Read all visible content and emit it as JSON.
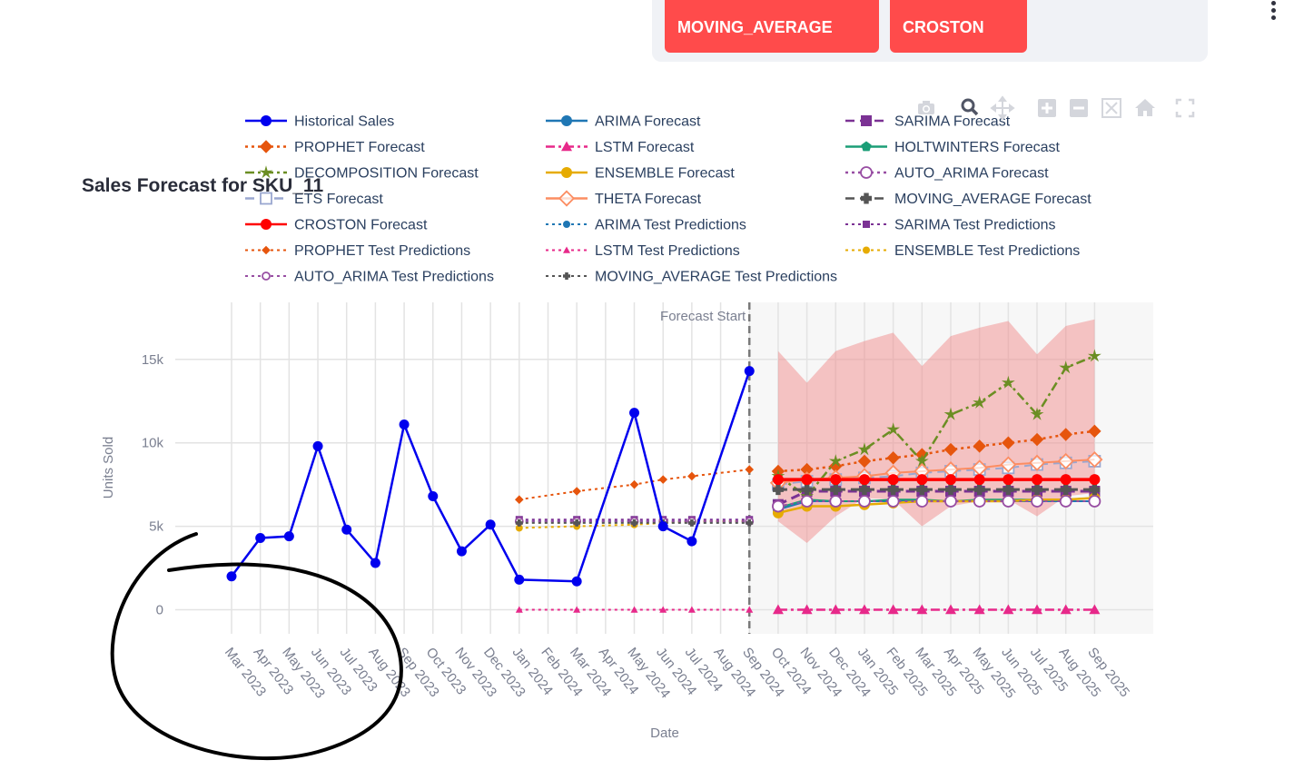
{
  "controls": {
    "buttons": [
      {
        "label": "MOVING_AVERAGE"
      },
      {
        "label": "CROSTON"
      }
    ]
  },
  "toolbar": {
    "icons": [
      "camera-icon",
      "zoom-icon",
      "pan-icon",
      "zoom-in-icon",
      "zoom-out-icon",
      "autoscale-icon",
      "reset-home-icon",
      "fullscreen-icon"
    ]
  },
  "chart_data": {
    "type": "line",
    "title": "Sales Forecast for SKU_11",
    "xlabel": "Date",
    "ylabel": "Units Sold",
    "ylim": [
      -1500,
      18500
    ],
    "yticks": [
      0,
      5000,
      10000,
      15000
    ],
    "ytick_labels": [
      "0",
      "5k",
      "10k",
      "15k"
    ],
    "grid": true,
    "legend_position": "top",
    "categories": [
      "Mar 2023",
      "Apr 2023",
      "May 2023",
      "Jun 2023",
      "Jul 2023",
      "Aug 2023",
      "Sep 2023",
      "Oct 2023",
      "Nov 2023",
      "Dec 2023",
      "Jan 2024",
      "Feb 2024",
      "Mar 2024",
      "Apr 2024",
      "May 2024",
      "Jun 2024",
      "Jul 2024",
      "Aug 2024",
      "Sep 2024",
      "Oct 2024",
      "Nov 2024",
      "Dec 2024",
      "Jan 2025",
      "Feb 2025",
      "Mar 2025",
      "Apr 2025",
      "May 2025",
      "Jun 2025",
      "Jul 2025",
      "Aug 2025",
      "Sep 2025"
    ],
    "annotation": "Forecast Start",
    "forecast_start": "Sep 2024",
    "confidence_band": {
      "x": [
        "Oct 2024",
        "Nov 2024",
        "Dec 2024",
        "Jan 2025",
        "Feb 2025",
        "Mar 2025",
        "Apr 2025",
        "May 2025",
        "Jun 2025",
        "Jul 2025",
        "Aug 2025",
        "Sep 2025"
      ],
      "upper": [
        15500,
        13600,
        15500,
        16100,
        16600,
        14600,
        16400,
        16900,
        17300,
        15300,
        17000,
        17400
      ],
      "lower": [
        5300,
        4000,
        5600,
        6700,
        6600,
        5000,
        6200,
        6500,
        6600,
        5600,
        6800,
        7000
      ],
      "color": "#f08080"
    },
    "series": [
      {
        "name": "Historical Sales",
        "color": "#0000ee",
        "dash": "solid",
        "marker": "circle",
        "width": 2.5,
        "x": [
          "Mar 2023",
          "Apr 2023",
          "May 2023",
          "Jun 2023",
          "Jul 2023",
          "Aug 2023",
          "Sep 2023",
          "Oct 2023",
          "Nov 2023",
          "Dec 2023",
          "Jan 2024",
          "Mar 2024",
          "May 2024",
          "Jun 2024",
          "Jul 2024",
          "Sep 2024"
        ],
        "y": [
          2000,
          4300,
          4400,
          9800,
          4800,
          2800,
          11100,
          6800,
          3500,
          5100,
          1800,
          1700,
          11800,
          5000,
          4100,
          14300
        ]
      },
      {
        "name": "ARIMA Forecast",
        "color": "#1f77b4",
        "dash": "solid",
        "marker": "circle",
        "width": 2,
        "x": [
          "Oct 2024",
          "Nov 2024",
          "Dec 2024",
          "Jan 2025",
          "Feb 2025",
          "Mar 2025",
          "Apr 2025",
          "May 2025",
          "Jun 2025",
          "Jul 2025",
          "Aug 2025",
          "Sep 2025"
        ],
        "y": [
          6000,
          6500,
          6500,
          6500,
          6500,
          6500,
          6500,
          6500,
          6500,
          6500,
          6500,
          6500
        ]
      },
      {
        "name": "SARIMA Forecast",
        "color": "#7b3294",
        "dash": "dash",
        "marker": "square",
        "width": 3,
        "x": [
          "Oct 2024",
          "Nov 2024",
          "Dec 2024",
          "Jan 2025",
          "Feb 2025",
          "Mar 2025",
          "Apr 2025",
          "May 2025",
          "Jun 2025",
          "Jul 2025",
          "Aug 2025",
          "Sep 2025"
        ],
        "y": [
          6300,
          7100,
          7100,
          7100,
          7100,
          7100,
          7100,
          7100,
          7100,
          7100,
          7100,
          7100
        ]
      },
      {
        "name": "PROPHET Forecast",
        "color": "#e6550d",
        "dash": "dot",
        "marker": "diamond",
        "width": 2.5,
        "x": [
          "Oct 2024",
          "Nov 2024",
          "Dec 2024",
          "Jan 2025",
          "Feb 2025",
          "Mar 2025",
          "Apr 2025",
          "May 2025",
          "Jun 2025",
          "Jul 2025",
          "Aug 2025",
          "Sep 2025"
        ],
        "y": [
          8300,
          8400,
          8600,
          8900,
          9100,
          9300,
          9600,
          9800,
          10000,
          10200,
          10500,
          10700
        ]
      },
      {
        "name": "LSTM Forecast",
        "color": "#e7298a",
        "dash": "dashdot",
        "marker": "triangle",
        "width": 2.5,
        "x": [
          "Oct 2024",
          "Nov 2024",
          "Dec 2024",
          "Jan 2025",
          "Feb 2025",
          "Mar 2025",
          "Apr 2025",
          "May 2025",
          "Jun 2025",
          "Jul 2025",
          "Aug 2025",
          "Sep 2025"
        ],
        "y": [
          0,
          0,
          0,
          0,
          0,
          0,
          0,
          0,
          0,
          0,
          0,
          0
        ]
      },
      {
        "name": "HOLTWINTERS Forecast",
        "color": "#1b9e77",
        "dash": "solid",
        "marker": "pentagon",
        "width": 2,
        "x": [
          "Oct 2024",
          "Nov 2024",
          "Dec 2024",
          "Jan 2025",
          "Feb 2025",
          "Mar 2025",
          "Apr 2025",
          "May 2025",
          "Jun 2025",
          "Jul 2025",
          "Aug 2025",
          "Sep 2025"
        ],
        "y": [
          6100,
          6600,
          6500,
          6500,
          6600,
          6600,
          6500,
          6600,
          6600,
          6600,
          6600,
          6700
        ]
      },
      {
        "name": "DECOMPOSITION Forecast",
        "color": "#6b8e23",
        "dash": "dashdot",
        "marker": "star",
        "width": 2.5,
        "x": [
          "Oct 2024",
          "Nov 2024",
          "Dec 2024",
          "Jan 2025",
          "Feb 2025",
          "Mar 2025",
          "Apr 2025",
          "May 2025",
          "Jun 2025",
          "Jul 2025",
          "Aug 2025",
          "Sep 2025"
        ],
        "y": [
          8000,
          6800,
          8900,
          9600,
          10800,
          8900,
          11700,
          12400,
          13600,
          11700,
          14500,
          15200
        ]
      },
      {
        "name": "ENSEMBLE Forecast",
        "color": "#e6ab02",
        "dash": "solid",
        "marker": "circle",
        "width": 2.5,
        "x": [
          "Oct 2024",
          "Nov 2024",
          "Dec 2024",
          "Jan 2025",
          "Feb 2025",
          "Mar 2025",
          "Apr 2025",
          "May 2025",
          "Jun 2025",
          "Jul 2025",
          "Aug 2025",
          "Sep 2025"
        ],
        "y": [
          5800,
          6200,
          6200,
          6300,
          6400,
          6500,
          6500,
          6500,
          6500,
          6600,
          6600,
          6700
        ]
      },
      {
        "name": "AUTO_ARIMA Forecast",
        "color": "#984ea3",
        "dash": "dot",
        "marker": "circle-open",
        "width": 2,
        "x": [
          "Oct 2024",
          "Nov 2024",
          "Dec 2024",
          "Jan 2025",
          "Feb 2025",
          "Mar 2025",
          "Apr 2025",
          "May 2025",
          "Jun 2025",
          "Jul 2025",
          "Aug 2025",
          "Sep 2025"
        ],
        "y": [
          6200,
          6500,
          6500,
          6500,
          6500,
          6500,
          6500,
          6500,
          6500,
          6500,
          6500,
          6500
        ]
      },
      {
        "name": "ETS Forecast",
        "color": "#9aa7d0",
        "dash": "dash",
        "marker": "square-open",
        "width": 2,
        "x": [
          "Oct 2024",
          "Nov 2024",
          "Dec 2024",
          "Jan 2025",
          "Feb 2025",
          "Mar 2025",
          "Apr 2025",
          "May 2025",
          "Jun 2025",
          "Jul 2025",
          "Aug 2025",
          "Sep 2025"
        ],
        "y": [
          7500,
          7700,
          7800,
          7900,
          8000,
          8200,
          8300,
          8400,
          8500,
          8700,
          8800,
          8900
        ]
      },
      {
        "name": "THETA Forecast",
        "color": "#fc8d62",
        "dash": "solid",
        "marker": "diamond-open",
        "width": 2,
        "x": [
          "Oct 2024",
          "Nov 2024",
          "Dec 2024",
          "Jan 2025",
          "Feb 2025",
          "Mar 2025",
          "Apr 2025",
          "May 2025",
          "Jun 2025",
          "Jul 2025",
          "Aug 2025",
          "Sep 2025"
        ],
        "y": [
          7600,
          7800,
          7900,
          8000,
          8200,
          8300,
          8400,
          8500,
          8700,
          8800,
          8900,
          9000
        ]
      },
      {
        "name": "MOVING_AVERAGE Forecast",
        "color": "#555555",
        "dash": "dash",
        "marker": "cross",
        "width": 3,
        "x": [
          "Oct 2024",
          "Nov 2024",
          "Dec 2024",
          "Jan 2025",
          "Feb 2025",
          "Mar 2025",
          "Apr 2025",
          "May 2025",
          "Jun 2025",
          "Jul 2025",
          "Aug 2025",
          "Sep 2025"
        ],
        "y": [
          7200,
          7200,
          7200,
          7200,
          7200,
          7200,
          7200,
          7200,
          7200,
          7200,
          7200,
          7200
        ]
      },
      {
        "name": "CROSTON Forecast",
        "color": "#ff0000",
        "dash": "solid",
        "marker": "circle",
        "width": 3.5,
        "x": [
          "Oct 2024",
          "Nov 2024",
          "Dec 2024",
          "Jan 2025",
          "Feb 2025",
          "Mar 2025",
          "Apr 2025",
          "May 2025",
          "Jun 2025",
          "Jul 2025",
          "Aug 2025",
          "Sep 2025"
        ],
        "y": [
          7800,
          7800,
          7800,
          7800,
          7800,
          7800,
          7800,
          7800,
          7800,
          7800,
          7800,
          7800
        ]
      },
      {
        "name": "ARIMA Test Predictions",
        "color": "#1f77b4",
        "dash": "dot",
        "marker": "circle",
        "width": 2,
        "x": [
          "Jan 2024",
          "Mar 2024",
          "May 2024",
          "Jun 2024",
          "Jul 2024",
          "Sep 2024"
        ],
        "y": [
          5300,
          5300,
          5300,
          5300,
          5300,
          5300
        ]
      },
      {
        "name": "SARIMA Test Predictions",
        "color": "#7b3294",
        "dash": "dot",
        "marker": "square",
        "width": 2,
        "x": [
          "Jan 2024",
          "Mar 2024",
          "May 2024",
          "Jun 2024",
          "Jul 2024",
          "Sep 2024"
        ],
        "y": [
          5400,
          5400,
          5400,
          5400,
          5400,
          5400
        ]
      },
      {
        "name": "PROPHET Test Predictions",
        "color": "#e6550d",
        "dash": "dot",
        "marker": "diamond",
        "width": 2,
        "x": [
          "Jan 2024",
          "Mar 2024",
          "May 2024",
          "Jun 2024",
          "Jul 2024",
          "Sep 2024"
        ],
        "y": [
          6600,
          7100,
          7500,
          7800,
          8000,
          8400
        ]
      },
      {
        "name": "LSTM Test Predictions",
        "color": "#e7298a",
        "dash": "dot",
        "marker": "triangle",
        "width": 2,
        "x": [
          "Jan 2024",
          "Mar 2024",
          "May 2024",
          "Jun 2024",
          "Jul 2024",
          "Sep 2024"
        ],
        "y": [
          0,
          0,
          0,
          0,
          0,
          0
        ]
      },
      {
        "name": "ENSEMBLE Test Predictions",
        "color": "#e6ab02",
        "dash": "dot",
        "marker": "circle",
        "width": 2,
        "x": [
          "Jan 2024",
          "Mar 2024",
          "May 2024",
          "Jun 2024",
          "Jul 2024",
          "Sep 2024"
        ],
        "y": [
          4900,
          5000,
          5100,
          5200,
          5300,
          5300
        ]
      },
      {
        "name": "AUTO_ARIMA Test Predictions",
        "color": "#984ea3",
        "dash": "dot",
        "marker": "circle-open",
        "width": 2,
        "x": [
          "Jan 2024",
          "Mar 2024",
          "May 2024",
          "Jun 2024",
          "Jul 2024",
          "Sep 2024"
        ],
        "y": [
          5300,
          5300,
          5300,
          5300,
          5300,
          5300
        ]
      },
      {
        "name": "MOVING_AVERAGE Test Predictions",
        "color": "#555555",
        "dash": "dot",
        "marker": "cross",
        "width": 2,
        "x": [
          "Jan 2024",
          "Mar 2024",
          "May 2024",
          "Jun 2024",
          "Jul 2024",
          "Sep 2024"
        ],
        "y": [
          5200,
          5200,
          5200,
          5200,
          5200,
          5200
        ]
      }
    ]
  }
}
